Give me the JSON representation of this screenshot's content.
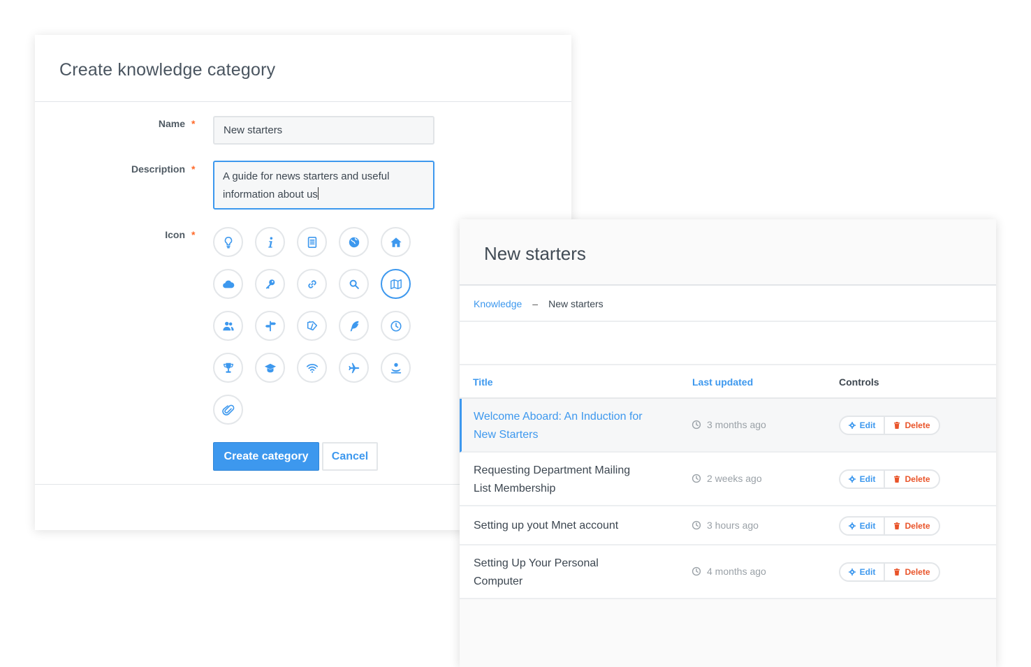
{
  "create_form": {
    "title": "Create knowledge category",
    "name_label": "Name",
    "description_label": "Description",
    "icon_label": "Icon",
    "required_mark": "*",
    "name_value": "New starters",
    "description_value": "A guide for news starters and useful information about us",
    "icons": [
      "lightbulb-icon",
      "info-icon",
      "document-icon",
      "globe-icon",
      "home-icon",
      "cloud-icon",
      "key-icon",
      "link-icon",
      "search-icon",
      "map-icon",
      "users-icon",
      "signpost-icon",
      "tags-icon",
      "feather-icon",
      "clock-icon",
      "trophy-icon",
      "graduation-cap-icon",
      "wifi-icon",
      "airplane-icon",
      "lifebuoy-icon",
      "paperclip-icon"
    ],
    "selected_icon": "map-icon",
    "create_button": "Create category",
    "cancel_button": "Cancel"
  },
  "category_view": {
    "title": "New starters",
    "breadcrumb": {
      "root": "Knowledge",
      "separator": "–",
      "current": "New starters"
    },
    "columns": {
      "title": "Title",
      "last_updated": "Last updated",
      "controls": "Controls"
    },
    "rows": [
      {
        "title": "Welcome Aboard: An Induction for New Starters",
        "updated": "3 months ago",
        "edit": "Edit",
        "delete": "Delete"
      },
      {
        "title": "Requesting Department Mailing List Membership",
        "updated": "2 weeks ago",
        "edit": "Edit",
        "delete": "Delete"
      },
      {
        "title": "Setting up yout Mnet account",
        "updated": "3 hours ago",
        "edit": "Edit",
        "delete": "Delete"
      },
      {
        "title": "Setting Up Your Personal Computer",
        "updated": "4 months ago",
        "edit": "Edit",
        "delete": "Delete"
      }
    ]
  },
  "colors": {
    "accent": "#3d98ee",
    "danger": "#e9542a",
    "required": "#ff6a2a",
    "muted": "#9aa1a7"
  }
}
